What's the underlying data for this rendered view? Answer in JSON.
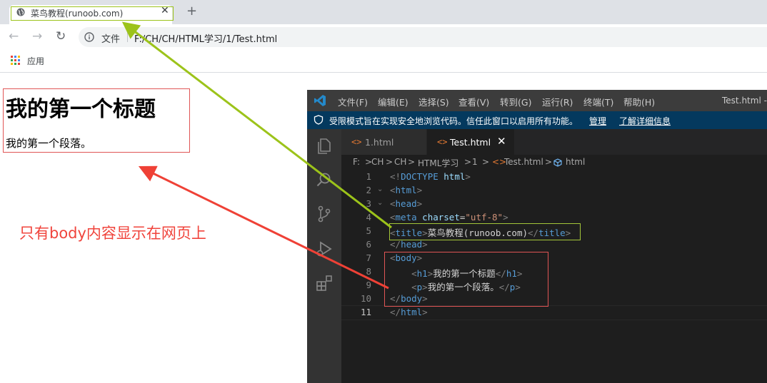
{
  "browser": {
    "tab_title": "菜鸟教程(runoob.com)",
    "tab_close": "✕",
    "new_tab": "+",
    "nav_back": "←",
    "nav_forward": "→",
    "nav_reload": "↻",
    "file_label": "文件",
    "url": "F:/CH/CH/HTML学习/1/Test.html",
    "bookmarks_apps": "应用"
  },
  "page": {
    "heading": "我的第一个标题",
    "paragraph": "我的第一个段落。"
  },
  "annotation": "只有body内容显示在网页上",
  "vscode": {
    "menu": [
      "文件(F)",
      "编辑(E)",
      "选择(S)",
      "查看(V)",
      "转到(G)",
      "运行(R)",
      "终端(T)",
      "帮助(H)"
    ],
    "window_title": "Test.html - V",
    "banner_text": "受限模式旨在实现安全地浏览代码。信任此窗口以启用所有功能。",
    "banner_manage": "管理",
    "banner_learn_more": "了解详细信息",
    "tabs": [
      {
        "icon": "<>",
        "label": "1.html"
      },
      {
        "icon": "<>",
        "label": "Test.html",
        "close": "✕"
      }
    ],
    "breadcrumbs": [
      "F:",
      ">",
      "CH",
      ">",
      "CH",
      ">",
      "HTML学习",
      ">",
      "1",
      ">",
      "<>",
      "Test.html",
      ">",
      "html"
    ],
    "line_numbers": [
      "1",
      "2",
      "3",
      "4",
      "5",
      "6",
      "7",
      "8",
      "9",
      "10",
      "11"
    ],
    "code": {
      "l1_open": "<!",
      "l1_tag": "DOCTYPE",
      "l1_name": " html",
      "l1_close": ">",
      "l2_open": "<",
      "l2_tag": "html",
      "l2_close": ">",
      "l3_open": "<",
      "l3_tag": "head",
      "l3_close": ">",
      "l4_open": "<",
      "l4_tag": "meta",
      "l4_attr": " charset",
      "l4_eq": "=",
      "l4_val": "\"utf-8\"",
      "l4_close": ">",
      "l5_open": "<",
      "l5_tag": "title",
      "l5_close": ">",
      "l5_text": "菜鸟教程(runoob.com)",
      "l5_end_open": "</",
      "l5_end_tag": "title",
      "l5_end_close": ">",
      "l6_open": "</",
      "l6_tag": "head",
      "l6_close": ">",
      "l7_open": "<",
      "l7_tag": "body",
      "l7_close": ">",
      "l8_indent": "    ",
      "l8_open": "<",
      "l8_tag": "h1",
      "l8_close": ">",
      "l8_text": "我的第一个标题",
      "l8_end_open": "</",
      "l8_end_tag": "h1",
      "l8_end_close": ">",
      "l9_indent": "    ",
      "l9_open": "<",
      "l9_tag": "p",
      "l9_close": ">",
      "l9_text": "我的第一个段落。",
      "l9_end_open": "</",
      "l9_end_tag": "p",
      "l9_end_close": ">",
      "l10_open": "</",
      "l10_tag": "body",
      "l10_close": ">",
      "l11_open": "</",
      "l11_tag": "html",
      "l11_close": ">"
    },
    "fold_marker": "⌄"
  },
  "colors": {
    "title_highlight": "#a4c639",
    "body_highlight": "#e05555",
    "annotation": "#f0443c"
  }
}
